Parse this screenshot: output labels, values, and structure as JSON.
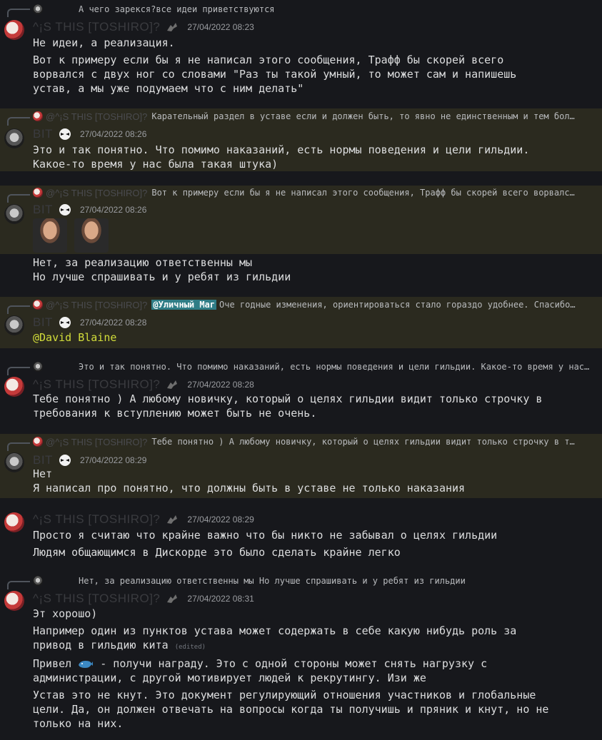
{
  "users": {
    "toshiro": "^¡S THIS [TOSHIRO]?",
    "toshiro_reply": "@^¡S THIS [TOSHIRO]?",
    "bit": "BIT"
  },
  "messages": [
    {
      "reply_name": "",
      "reply_text": "А чего зарекся?все идеи приветствуются",
      "time": "27/04/2022 08:23",
      "lines": [
        "Не идеи, а реализация.",
        "Вот к примеру если бы я не написал этого сообщения, Трафф бы скорей всего\nворвался с двух ног со словами \"Раз ты такой умный, то может сам и напишешь\nустав, а мы уже подумаем что с ним делать\""
      ]
    },
    {
      "reply_text": "Карательный раздел в уставе если и должен быть, то явно не единственным и тем бол…",
      "time": "27/04/2022 08:26",
      "lines": [
        "Это и так понятно. Что помимо наказаний, есть нормы поведения и цели гильдии.\nКакое-то время у нас была такая штука)"
      ]
    },
    {
      "reply_text": "Вот к примеру если бы я не написал этого сообщения, Трафф бы скорей всего ворвалс…",
      "time": "27/04/2022 08:26",
      "lines": [
        "Нет, за реализацию ответственны мы\nНо лучше спрашивать и у ребят из гильдии"
      ]
    },
    {
      "reply_mention": "@Уличный Маг",
      "reply_text": "Оче годные изменения, ориентироваться стало гораздо удобнее. Спасибо…",
      "time": "27/04/2022 08:28",
      "mention": "@David Blaine"
    },
    {
      "reply_text": "Это и так понятно. Что помимо наказаний, есть нормы поведения и цели гильдии. Какое-то время у нас…",
      "time": "27/04/2022 08:28",
      "lines": [
        "Тебе понятно ) А любому новичку, который о целях гильдии видит только строчку в\nтребования к вступлению может быть не очень."
      ]
    },
    {
      "reply_text": "Тебе понятно ) А любому новичку, который о целях гильдии видит только строчку в т…",
      "time": "27/04/2022 08:29",
      "lines": [
        "Нет\nЯ написал про понятно, что должны быть в уставе не только наказания"
      ]
    },
    {
      "time": "27/04/2022 08:29",
      "lines": [
        "Просто я считаю что крайне важно что бы никто не забывал о целях гильдии",
        "Людям общающимся в Дискорде это было сделать крайне легко"
      ]
    },
    {
      "reply_text": "Нет, за реализацию ответственны мы Но лучше спрашивать и у ребят из гильдии",
      "time": "27/04/2022 08:31",
      "lines": [
        "Эт хорошо)",
        "Например один из пунктов устава может содержать в себе какую нибудь роль за\nпривод в гильдию кита",
        "Привел ",
        " - получи награду. Это с одной стороны может снять нагрузку с\nадминистрации, с другой мотивирует людей к рекрутингу. Изи же",
        "Устав это не кнут. Это документ регулирующий отношения участников и глобальные\nцели. Да, он должен отвечать на вопросы когда ты получишь и пряник и кнут, но не\nтолько на них."
      ],
      "edited": "(edited)"
    }
  ]
}
